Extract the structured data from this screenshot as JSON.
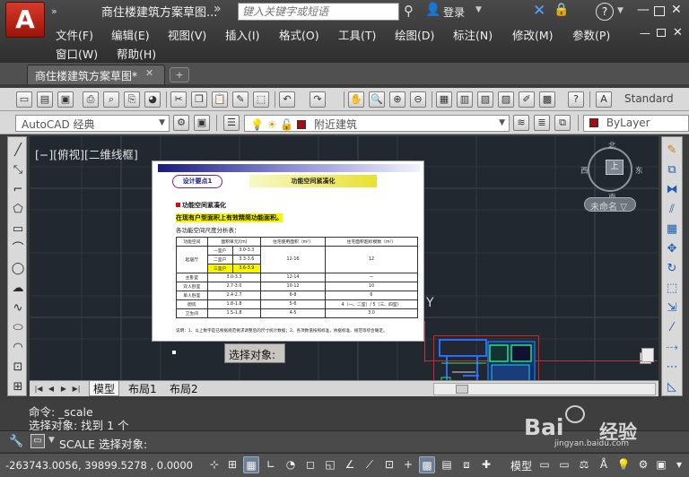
{
  "app": {
    "logo_letter": "A",
    "qa_arrows": "»",
    "title": "商住楼建筑方案草图...",
    "title_more": "»",
    "search_placeholder": "键入关键字或短语",
    "login": "登录",
    "help": "?",
    "window_min": "—",
    "window_close": "✕"
  },
  "menu": [
    "文件(F)",
    "编辑(E)",
    "视图(V)",
    "插入(I)",
    "格式(O)",
    "工具(T)",
    "绘图(D)",
    "标注(N)",
    "修改(M)",
    "参数(P)",
    "窗口(W)",
    "帮助(H)"
  ],
  "doc_tabs": {
    "active": "商住楼建筑方案草图*",
    "close": "✕",
    "new_tab": "+"
  },
  "toolbar": {
    "text_style": "Standard",
    "workspace": "AutoCAD 经典",
    "layer": "附近建筑",
    "color": "ByLayer",
    "colors": {
      "layer_swatch": "#a30d17"
    }
  },
  "canvas": {
    "view_label": "[−][俯视][二维线框]",
    "compass": {
      "north": "北",
      "south": "南",
      "east": "东",
      "west": "西",
      "top": "上"
    },
    "unnamed_ucs": "未命名",
    "ucs_axis": "Y",
    "prompt_tip": "选择对象:"
  },
  "document_image": {
    "pill": "设计要点1",
    "heading": "功能空间紧凑化",
    "section": "功能空间紧凑化",
    "highlight_line": "在现有户型面积上有效精简功能面积。",
    "intro": "各功能空间尺度分析表：",
    "table": {
      "headers": [
        "功能空间",
        "面积单元/(m)",
        "",
        "住宅使用面积（m²）",
        "住宅面积超标模数（m²）"
      ],
      "rows": [
        [
          "起居厅",
          "一室户",
          "3.0-3.3",
          "12-16",
          "12"
        ],
        [
          "",
          "二室户",
          "3.3-3.6",
          "",
          ""
        ],
        [
          "",
          "三室户",
          "3.6-3.9",
          "",
          ""
        ],
        [
          "主卧室",
          "",
          "3.0-3.3",
          "12-14",
          "—"
        ],
        [
          "双人卧室",
          "",
          "2.7-3.0",
          "10-12",
          "10"
        ],
        [
          "单人卧室",
          "",
          "2.4-2.7",
          "6-8",
          "6"
        ],
        [
          "厨房",
          "",
          "1.8-1.8",
          "5-6",
          "4（一、二室）/ 5（三、四室）"
        ],
        [
          "卫生间",
          "",
          "1.5-1.8",
          "4-5",
          "3.0"
        ]
      ]
    },
    "note": "说明：1、以上数字是已根据规范要求调整后的尺寸统计数据；2、各项数值按照标准，依据标准、规范等综合确定。"
  },
  "layout_tabs": [
    "模型",
    "布局1",
    "布局2"
  ],
  "command": {
    "line1": "命令: _scale",
    "line2": "选择对象: 找到 1 个",
    "prompt": "SCALE 选择对象:"
  },
  "status": {
    "coords": "-263743.0056, 39899.5278 , 0.0000",
    "model": "模型"
  },
  "watermark": {
    "brand": "Bai",
    "brand_cn": "经验",
    "url": "jingyan.baidu.com"
  }
}
